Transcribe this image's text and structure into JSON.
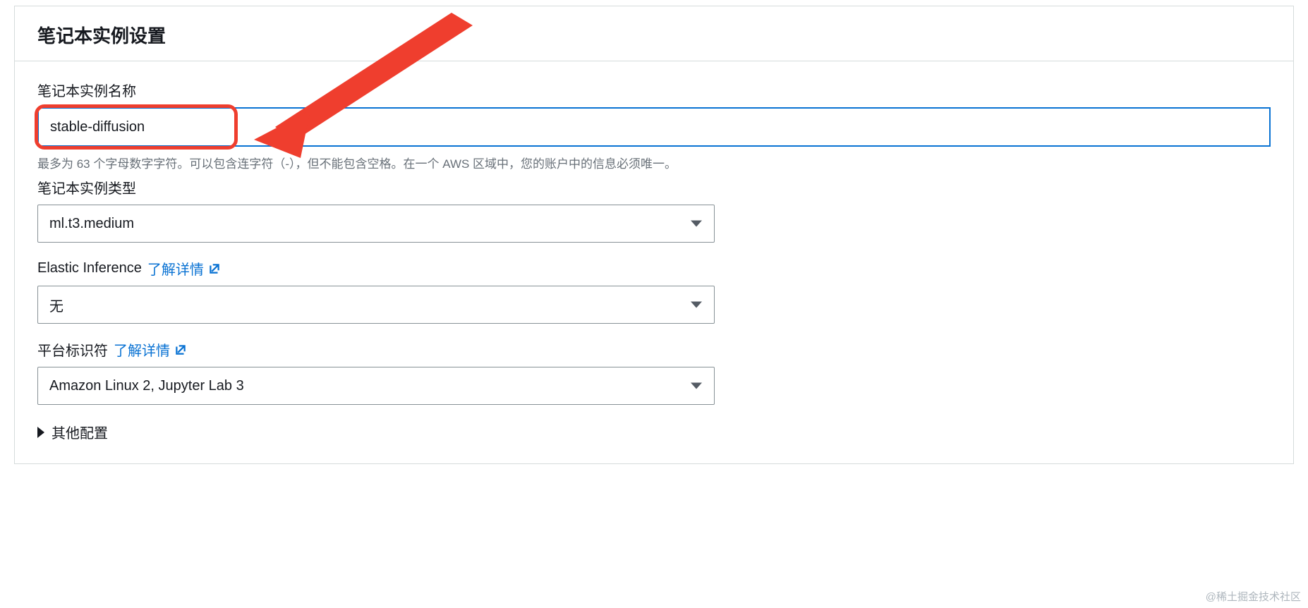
{
  "panel": {
    "title": "笔记本实例设置"
  },
  "fields": {
    "name": {
      "label": "笔记本实例名称",
      "value": "stable-diffusion",
      "help": "最多为 63 个字母数字字符。可以包含连字符（-），但不能包含空格。在一个 AWS 区域中，您的账户中的信息必须唯一。"
    },
    "type": {
      "label": "笔记本实例类型",
      "value": "ml.t3.medium"
    },
    "elastic": {
      "label": "Elastic Inference",
      "link": "了解详情",
      "value": "无"
    },
    "platform": {
      "label": "平台标识符",
      "link": "了解详情",
      "value": "Amazon Linux 2, Jupyter Lab 3"
    }
  },
  "expand": {
    "label": "其他配置"
  },
  "watermark": "@稀土掘金技术社区",
  "colors": {
    "accent": "#0972d3",
    "highlight": "#ef3e2e",
    "border": "#d5dbdb",
    "text_muted": "#687078"
  }
}
